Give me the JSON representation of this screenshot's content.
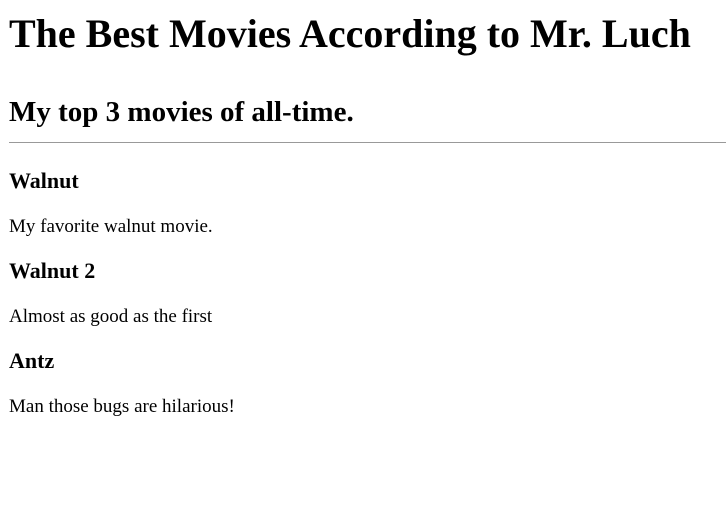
{
  "header": {
    "title": "The Best Movies According to Mr. Luch",
    "subtitle": "My top 3 movies of all-time."
  },
  "movies": [
    {
      "title": "Walnut",
      "description": "My favorite walnut movie."
    },
    {
      "title": "Walnut 2",
      "description": "Almost as good as the first"
    },
    {
      "title": "Antz",
      "description": "Man those bugs are hilarious!"
    }
  ]
}
